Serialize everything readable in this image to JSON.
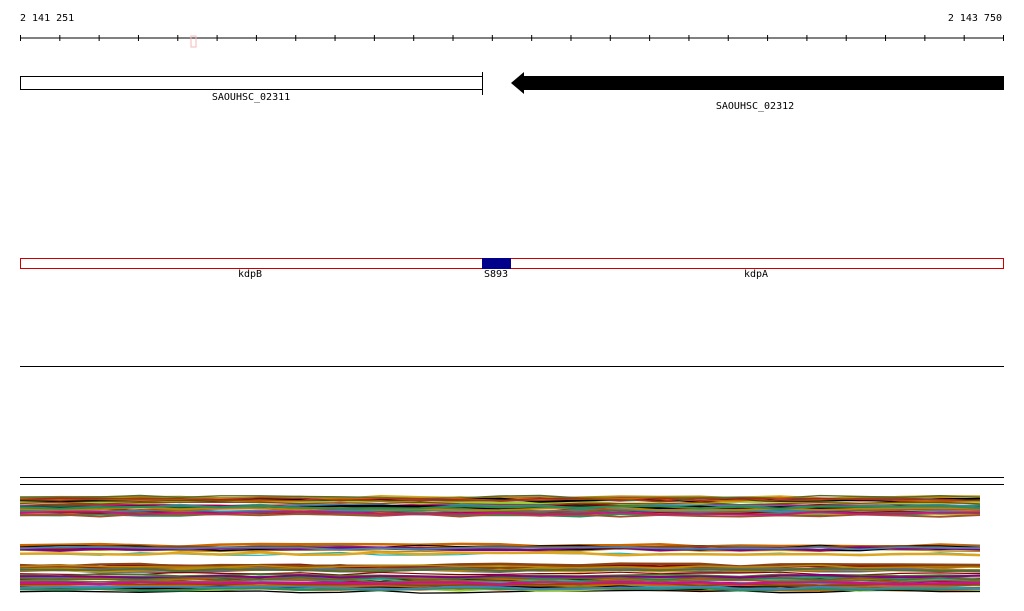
{
  "ruler": {
    "start_label": "2 141 251",
    "end_label": "2 143 750"
  },
  "genes": [
    {
      "name": "SAOUHSC_02311",
      "strand": "forward",
      "style": "outlined",
      "color": "#000000"
    },
    {
      "name": "SAOUHSC_02312",
      "strand": "reverse",
      "style": "filled",
      "color": "#000000"
    }
  ],
  "features": [
    {
      "name": "kdpB",
      "color": "#cc0000"
    },
    {
      "name": "S893",
      "color": "#00008b"
    },
    {
      "name": "kdpA",
      "color": "#cc0000"
    }
  ],
  "colors": {
    "feature_outline": "#cc0000",
    "highlight_block": "#00008b",
    "ruler": "#000000",
    "ruler_marker": "#f4b8b8"
  }
}
